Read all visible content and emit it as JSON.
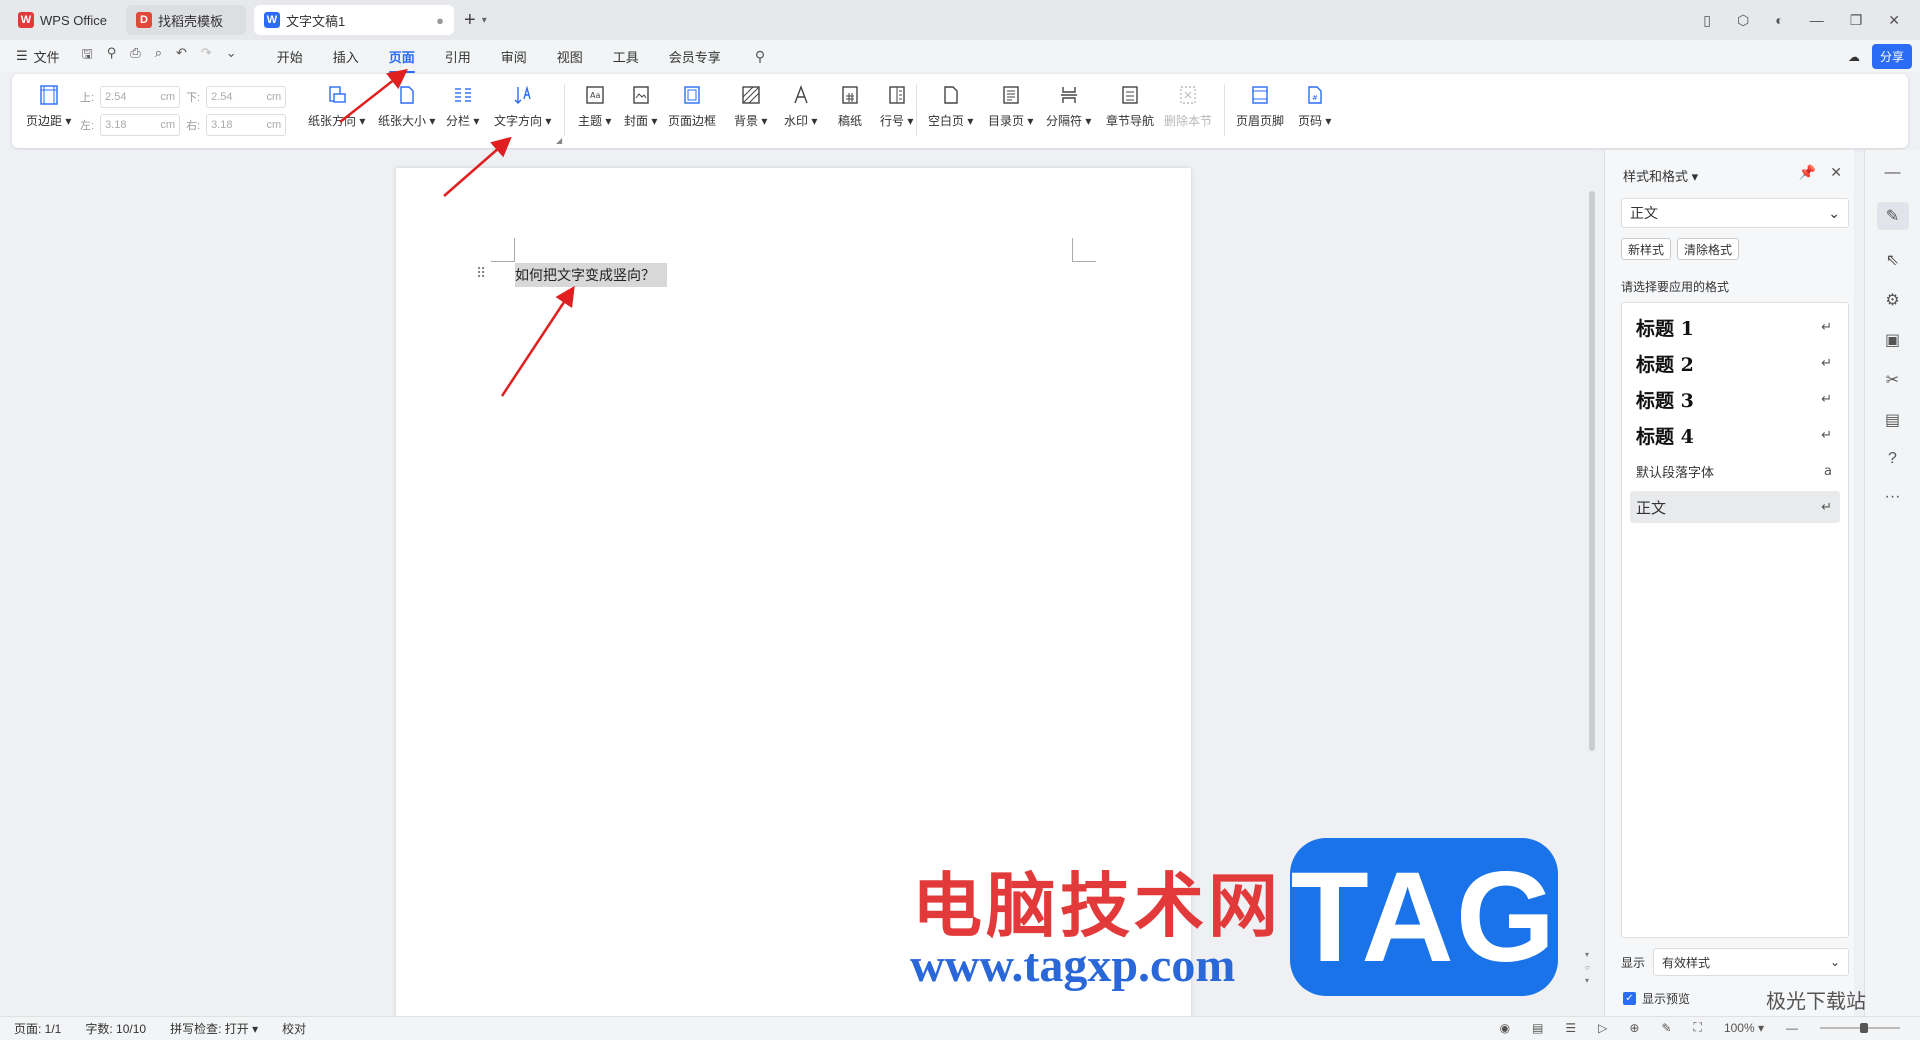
{
  "titlebar": {
    "tabs": [
      {
        "label": "WPS Office"
      },
      {
        "label": "找稻壳模板"
      },
      {
        "label": "文字文稿1"
      }
    ],
    "new_tab": "+"
  },
  "menubar": {
    "file_label": "文件",
    "menus": [
      "开始",
      "插入",
      "页面",
      "引用",
      "审阅",
      "视图",
      "工具",
      "会员专享"
    ],
    "active_menu": "页面",
    "share_label": "分享"
  },
  "ribbon": {
    "page_margins": "页边距",
    "margin_top_label": "上:",
    "margin_top_value": "2.54",
    "margin_bottom_label": "下:",
    "margin_bottom_value": "2.54",
    "margin_left_label": "左:",
    "margin_left_value": "3.18",
    "margin_right_label": "右:",
    "margin_right_value": "3.18",
    "unit": "cm",
    "orientation": "纸张方向",
    "paper_size": "纸张大小",
    "columns": "分栏",
    "text_direction": "文字方向",
    "theme": "主题",
    "cover": "封面",
    "page_border": "页面边框",
    "background": "背景",
    "watermark": "水印",
    "manuscript": "稿纸",
    "line_numbers": "行号",
    "blank_page": "空白页",
    "toc_page": "目录页",
    "separator": "分隔符",
    "section_nav": "章节导航",
    "delete_section": "删除本节",
    "header_footer": "页眉页脚",
    "page_number": "页码"
  },
  "document": {
    "text": "如何把文字变成竖向？"
  },
  "watermark_overlay": {
    "site_cn": "电脑技术网",
    "url": "www.tagxp.com",
    "tag": "TAG",
    "corner_site": "极光下载站"
  },
  "style_panel": {
    "title": "样式和格式",
    "current_style": "正文",
    "new_style": "新样式",
    "clear_format": "清除格式",
    "prompt": "请选择要应用的格式",
    "styles": [
      "标题 1",
      "标题 2",
      "标题 3",
      "标题 4",
      "默认段落字体",
      "正文"
    ],
    "show_label": "显示",
    "show_value": "有效样式",
    "preview_label": "显示预览"
  },
  "status": {
    "page": "页面: 1/1",
    "words": "字数: 10/10",
    "spell": "拼写检查: 打开",
    "proof": "校对",
    "zoom": "100%"
  },
  "colors": {
    "accent": "#2b6cf5",
    "arrow": "#e02020",
    "watermark_red": "#e23a3a",
    "watermark_blue": "#1a73e8"
  }
}
